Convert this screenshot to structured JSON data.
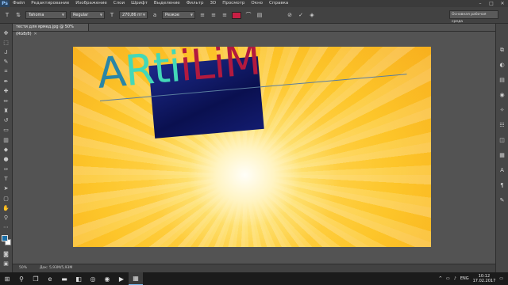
{
  "menubar": {
    "logo": "Ps",
    "items": [
      "Файл",
      "Редактирование",
      "Изображение",
      "Слои",
      "Шрифт",
      "Выделение",
      "Фильтр",
      "3D",
      "Просмотр",
      "Окно",
      "Справка"
    ],
    "controls": [
      "–",
      "□",
      "✕"
    ]
  },
  "options": {
    "font_family": "Tahoma",
    "font_style": "Regular",
    "font_size": "270,86 пт",
    "antialias": "Резкое",
    "text_color": "#c81f44",
    "workspace": "Основная рабочая среда"
  },
  "document": {
    "tab": "тести для ярмед.jpg @ 50% (RGB/8)",
    "zoom": "50%",
    "doc_info": "Док: 5,93M/5,93M"
  },
  "canvas_text": {
    "part1": "A",
    "part2": "Rti",
    "part3": "iLiM"
  },
  "taskbar": {
    "language": "ENG",
    "time": "10:12",
    "date": "17.02.2017"
  }
}
